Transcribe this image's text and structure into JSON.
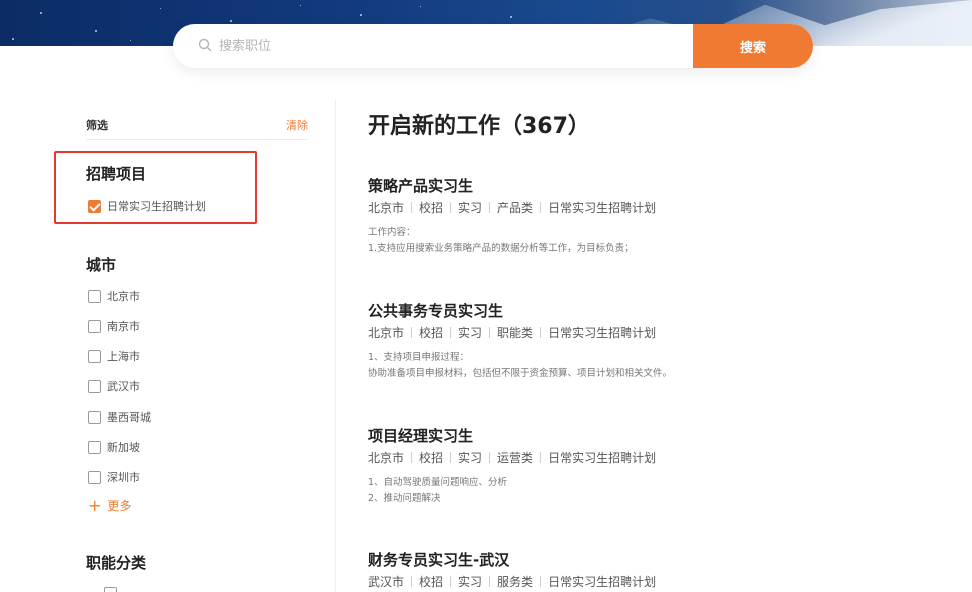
{
  "search": {
    "placeholder": "搜索职位",
    "button_label": "搜索",
    "accent_color": "#f07a32"
  },
  "sidebar": {
    "filter_title": "筛选",
    "clear_label": "清除",
    "sections": [
      {
        "title": "招聘项目",
        "options": [
          {
            "label": "日常实习生招聘计划",
            "checked": true
          }
        ]
      },
      {
        "title": "城市",
        "options": [
          {
            "label": "北京市",
            "checked": false
          },
          {
            "label": "南京市",
            "checked": false
          },
          {
            "label": "上海市",
            "checked": false
          },
          {
            "label": "武汉市",
            "checked": false
          },
          {
            "label": "墨西哥城",
            "checked": false
          },
          {
            "label": "新加坡",
            "checked": false
          },
          {
            "label": "深圳市",
            "checked": false
          }
        ],
        "more_label": "更多"
      },
      {
        "title": "职能分类",
        "options": [
          {
            "label": "",
            "checked": false
          }
        ]
      }
    ]
  },
  "main": {
    "title": "开启新的工作（367）",
    "jobs": [
      {
        "title": "策略产品实习生",
        "tags": [
          "北京市",
          "校招",
          "实习",
          "产品类",
          "日常实习生招聘计划"
        ],
        "desc": [
          "工作内容：",
          "1.支持应用搜索业务策略产品的数据分析等工作，为目标负责；"
        ]
      },
      {
        "title": "公共事务专员实习生",
        "tags": [
          "北京市",
          "校招",
          "实习",
          "职能类",
          "日常实习生招聘计划"
        ],
        "desc": [
          "1、支持项目申报过程：",
          "协助准备项目申报材料，包括但不限于资金预算、项目计划和相关文件。"
        ]
      },
      {
        "title": "项目经理实习生",
        "tags": [
          "北京市",
          "校招",
          "实习",
          "运营类",
          "日常实习生招聘计划"
        ],
        "desc": [
          "1、自动驾驶质量问题响应、分析",
          "2、推动问题解决"
        ]
      },
      {
        "title": "财务专员实习生-武汉",
        "tags": [
          "武汉市",
          "校招",
          "实习",
          "服务类",
          "日常实习生招聘计划"
        ],
        "desc": []
      }
    ]
  }
}
